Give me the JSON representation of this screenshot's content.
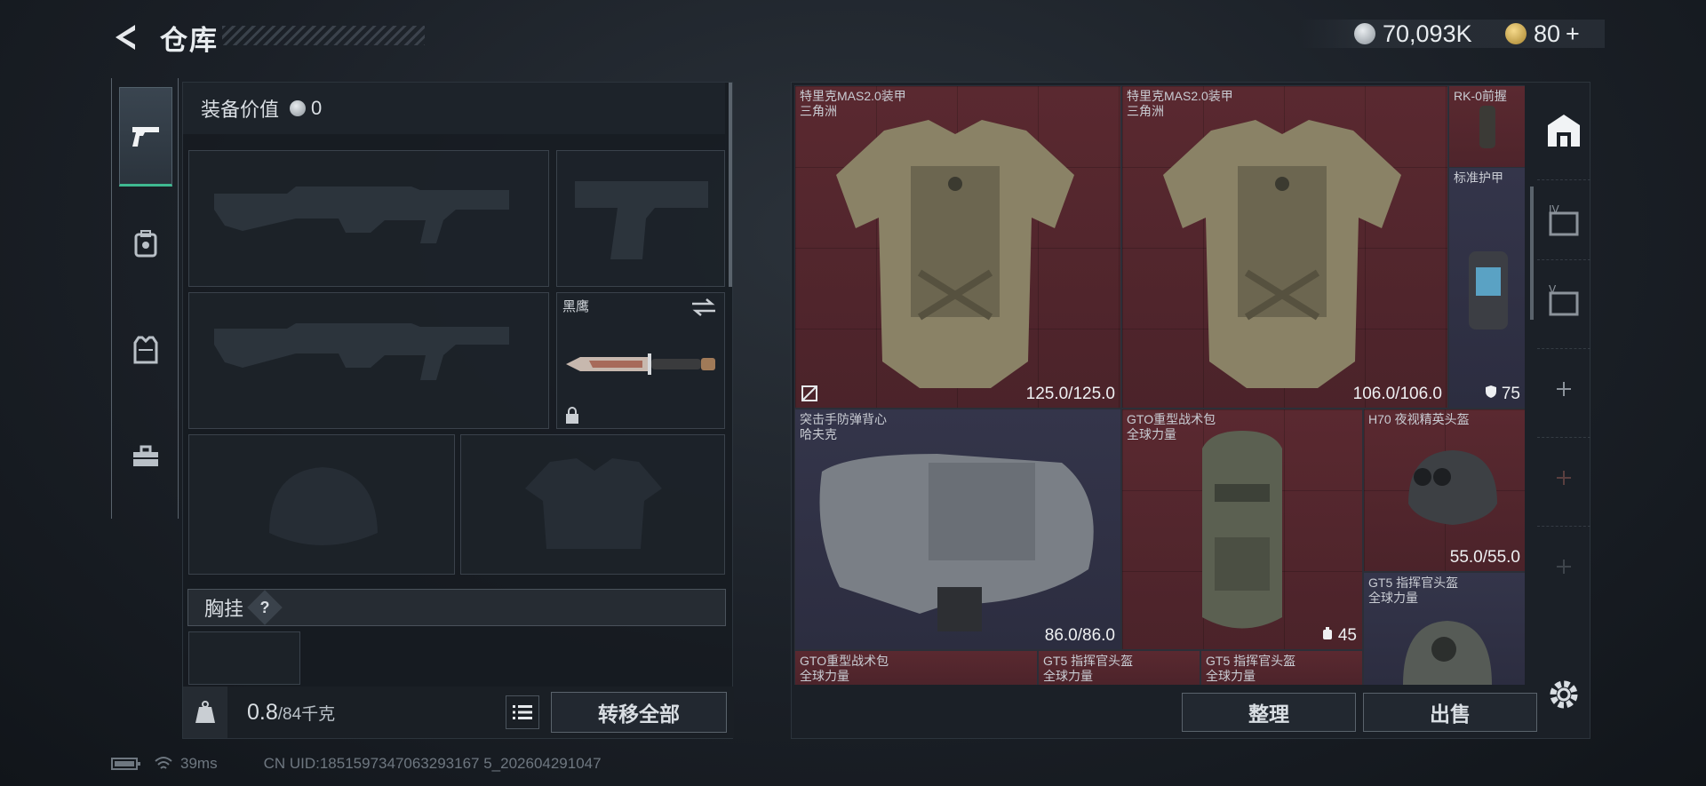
{
  "header": {
    "title": "仓库"
  },
  "currency": {
    "silver": "70,093K",
    "gold": "80",
    "gold_plus": "+"
  },
  "equipment": {
    "value_label": "装备价值",
    "value": "0",
    "melee_name": "黑鹰",
    "chest_label": "胸挂",
    "help": "?"
  },
  "footer_left": {
    "weight_current": "0.8",
    "weight_max": "/84千克",
    "transfer_all": "转移全部"
  },
  "inventory": {
    "items": [
      {
        "name": "特里克MAS2.0装甲\n三角洲",
        "durability": "125.0/125.0"
      },
      {
        "name": "特里克MAS2.0装甲\n三角洲",
        "durability": "106.0/106.0"
      },
      {
        "name": "RK-0前握"
      },
      {
        "name": "标准护甲",
        "level": "75"
      },
      {
        "name": "突击手防弹背心\n哈夫克",
        "durability": "86.0/86.0"
      },
      {
        "name": "GTO重型战术包\n全球力量",
        "count": "45"
      },
      {
        "name": "H70 夜视精英头盔",
        "durability": "55.0/55.0"
      },
      {
        "name": "GT5 指挥官头盔\n全球力量"
      },
      {
        "name": "GTO重型战术包\n全球力量"
      },
      {
        "name": "GT5 指挥官头盔\n全球力量"
      },
      {
        "name": "GT5 指挥官头盔\n全球力量"
      }
    ]
  },
  "footer_right": {
    "organize": "整理",
    "sell": "出售"
  },
  "status": {
    "ping": "39ms",
    "uid": "CN UID:1851597347063293167 5_202604291047"
  },
  "colors": {
    "accent": "#3fb991",
    "red_cell": "#52272d",
    "blue_cell": "#30314a"
  },
  "icons": [
    "back-arrow-icon",
    "silver-coin-icon",
    "gold-coin-icon",
    "pistol-icon",
    "backpack-icon",
    "vest-icon",
    "toolbox-icon",
    "swap-icon",
    "lock-icon",
    "weight-icon",
    "list-icon",
    "settings-icon",
    "shield-icon",
    "helmet-icon"
  ]
}
